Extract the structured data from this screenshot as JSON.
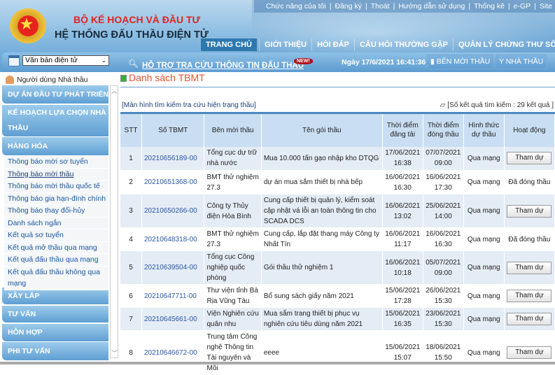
{
  "header": {
    "org": "BỘ KẾ HOẠCH VÀ ĐẦU TƯ",
    "system": "HỆ THỐNG ĐẤU THẦU ĐIỆN TỬ",
    "top_links": [
      "Chức năng của tôi",
      "Đăng ký",
      "Thoát",
      "Hướng dẫn sử dụng",
      "Thống kê",
      "e-GP",
      "Site"
    ],
    "nav": [
      "TRANG CHỦ",
      "GIỚI THIỆU",
      "HỎI ĐÁP",
      "CÂU HỎI THƯỜNG GẶP",
      "QUẢN LÝ CHỨNG THƯ SỐ"
    ],
    "doc_select": "Văn bản điện tử",
    "support_link": "HỖ TRỢ TRA CỨU THÔNG TIN ĐẤU THẦU",
    "new_badge": "NEW!",
    "datetime": "Ngày 17/6/2021 16:41:36",
    "btn_procuring": "BÊN MỜI THẦU",
    "btn_bidder": "NHÀ THẦU"
  },
  "sidebar": {
    "user": "Người dùng Nhà thầu",
    "categories": [
      "DỰ ÁN ĐẦU TƯ PHÁT TRIỂN",
      "KẾ HOẠCH LỰA CHỌN NHÀ THẦU",
      "HÀNG HÓA",
      "XÂY LẮP",
      "TƯ VẤN",
      "HỖN HỢP",
      "PHI TƯ VẤN"
    ],
    "items": [
      "Thông báo mời sơ tuyển",
      "Thông báo mời thầu",
      "Thông báo mời thầu quốc tế",
      "Thông báo gia hạn-đính chính",
      "Thông báo thay đổi-hủy",
      "Danh sách ngắn",
      "Kết quả sơ tuyển",
      "Kết quả mở thầu qua mạng",
      "Kết quả đấu thầu qua mạng",
      "Kết quả đấu thầu không qua mạng"
    ]
  },
  "main": {
    "title": "Danh sách TBMT",
    "search_link": "[Màn hình tìm kiếm tra cứu hiện trạng thầu]",
    "result_count": "[Số kết quả tìm kiếm : 29 kết quả ]",
    "columns": [
      "STT",
      "Số TBMT",
      "Bên mời thầu",
      "Tên gói thầu",
      "Thời điểm đăng tải",
      "Thời điểm đóng thầu",
      "Hình thức dự thầu",
      "Hoạt động"
    ],
    "rows": [
      {
        "stt": "1",
        "id": "20210656189-00",
        "owner": "Tổng cục dự trữ nhà nước",
        "name": "Mua 10.000 tấn gạo nhập kho DTQG",
        "posted": "17/06/2021 16:38",
        "closing": "07/07/2021 09:00",
        "form": "Qua mạng",
        "action": "Tham dự",
        "is_button": true
      },
      {
        "stt": "2",
        "id": "20210651368-00",
        "owner": "BMT thử nghiệm 27.3",
        "name": "dự án mua sắm thiết bị nhà bếp",
        "posted": "16/06/2021 16:30",
        "closing": "16/06/2021 17:30",
        "form": "Qua mạng",
        "action": "Đã đóng thầu",
        "is_button": false
      },
      {
        "stt": "3",
        "id": "20210650266-00",
        "owner": "Công ty Thủy điện Hòa Bình",
        "name": "Cung cấp thiết bị quản lý, kiểm soát cập nhật vá lỗi an toàn thông tin cho SCADA DCS",
        "posted": "16/06/2021 13:02",
        "closing": "25/06/2021 14:00",
        "form": "Qua mạng",
        "action": "Tham dự",
        "is_button": true
      },
      {
        "stt": "4",
        "id": "20210648318-00",
        "owner": "BMT thử nghiệm 27.3",
        "name": "Cung cấp, lắp đặt thang máy Công ty Nhất Tín",
        "posted": "16/06/2021 11:17",
        "closing": "16/06/2021 16:30",
        "form": "Qua mạng",
        "action": "Đã đóng thầu",
        "is_button": false
      },
      {
        "stt": "5",
        "id": "20210639504-00",
        "owner": "Tổng cục Công nghiệp quốc phòng",
        "name": "Gói thầu thử nghiệm 1",
        "posted": "16/06/2021 10:18",
        "closing": "05/07/2021 09:00",
        "form": "Qua mạng",
        "action": "Tham dự",
        "is_button": true
      },
      {
        "stt": "6",
        "id": "20210647711-00",
        "owner": "Thư viện tỉnh Bà Rịa Vũng Tàu",
        "name": "Bổ sung sách giấy năm 2021",
        "posted": "15/06/2021 17:28",
        "closing": "26/06/2021 15:30",
        "form": "Qua mạng",
        "action": "Tham dự",
        "is_button": true
      },
      {
        "stt": "7",
        "id": "20210645661-00",
        "owner": "Viện Nghiên cứu quân nhu",
        "name": "Mua sắm trang thiết bị phục vụ nghiên cứu tiêu dùng năm 2021",
        "posted": "15/06/2021 16:35",
        "closing": "23/06/2021 15:30",
        "form": "Qua mạng",
        "action": "Tham dự",
        "is_button": true
      },
      {
        "stt": "8",
        "id": "20210646672-00",
        "owner": "Trung tâm Công nghệ Thông tin Tài nguyên và Môi",
        "name": "eeee",
        "posted": "15/06/2021 15:07",
        "closing": "18/06/2021 15:50",
        "form": "Qua mạng",
        "action": "Tham dự",
        "is_button": true
      }
    ]
  }
}
